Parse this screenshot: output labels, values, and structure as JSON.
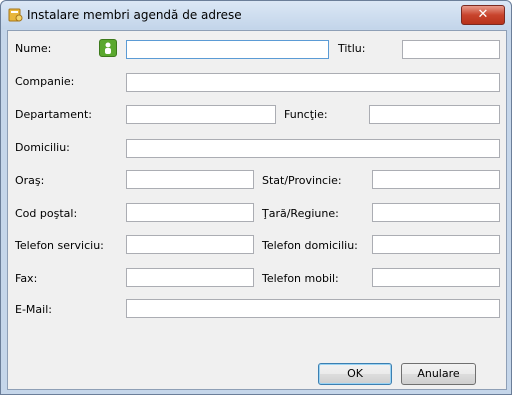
{
  "window": {
    "title": "Instalare membri agendă de adrese",
    "close_symbol": "✕",
    "app_icon": "address-book-icon",
    "contact_icon": "contact-person-icon"
  },
  "form": {
    "nume_label": "Nume:",
    "titlu_label": "Titlu:",
    "companie_label": "Companie:",
    "departament_label": "Departament:",
    "functie_label": "Funcţie:",
    "domiciliu_label": "Domiciliu:",
    "oras_label": "Oraş:",
    "stat_label": "Stat/Provincie:",
    "cod_postal_label": "Cod poştal:",
    "tara_label": "Ţară/Regiune:",
    "telefon_serviciu_label": "Telefon serviciu:",
    "telefon_domiciliu_label": "Telefon domiciliu:",
    "fax_label": "Fax:",
    "telefon_mobil_label": "Telefon mobil:",
    "email_label": "E-Mail:",
    "values": {
      "nume": "",
      "titlu": "",
      "companie": "",
      "departament": "",
      "functie": "",
      "domiciliu": "",
      "oras": "",
      "stat": "",
      "cod_postal": "",
      "tara": "",
      "telefon_serviciu": "",
      "telefon_domiciliu": "",
      "fax": "",
      "telefon_mobil": "",
      "email": ""
    }
  },
  "buttons": {
    "ok_label": "OK",
    "cancel_label": "Anulare"
  },
  "colors": {
    "accent": "#3c7fb1",
    "close": "#c8442d",
    "contact_icon": "#5aa82e"
  }
}
